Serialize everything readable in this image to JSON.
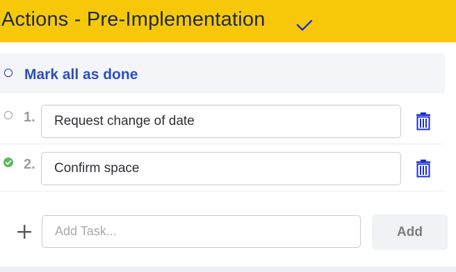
{
  "header": {
    "title": "Actions - Pre-Implementation",
    "check_icon": "checkmark-icon",
    "background": "#f7c80a"
  },
  "mark_all": {
    "label": "Mark all as done"
  },
  "tasks": [
    {
      "number": "1.",
      "value": "Request change of date",
      "done": false
    },
    {
      "number": "2.",
      "value": "Confirm space",
      "done": true
    }
  ],
  "new_task": {
    "placeholder": "Add Task...",
    "value": "",
    "add_label": "Add"
  },
  "colors": {
    "accent_blue": "#2a4fc4",
    "done_green": "#5cb85c",
    "trash_blue": "#1c2fd0"
  }
}
